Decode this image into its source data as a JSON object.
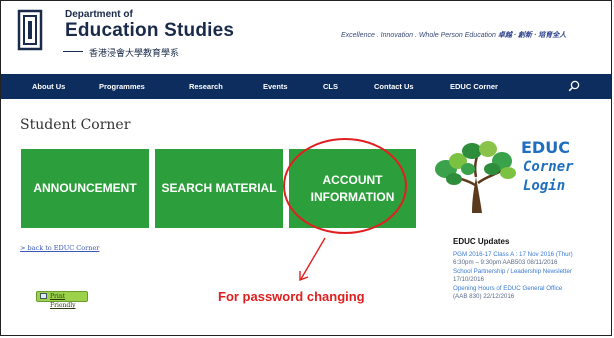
{
  "header": {
    "dept_line1": "Department of",
    "dept_line2": "Education Studies",
    "dept_line3": "香港浸會大學教育學系",
    "tagline": "Excellence . Innovation . Whole Person Education",
    "tagline_zh": "卓越 · 創新 · 培育全人"
  },
  "nav": {
    "items": [
      "About Us",
      "Programmes",
      "Research",
      "Events",
      "CLS",
      "Contact Us",
      "EDUC Corner"
    ],
    "search_icon": "search-icon",
    "background": "#0d2d5e"
  },
  "main": {
    "title": "Student Corner",
    "tiles": [
      "ANNOUNCEMENT",
      "SEARCH MATERIAL",
      "ACCOUNT\nINFORMATION"
    ],
    "tile_color": "#2d9e3c",
    "back_link": "> back to EDUC Corner",
    "print_button": "Print Friendly",
    "annotation": "For password changing",
    "annotation_color": "#e01f1f"
  },
  "sidebar": {
    "logo_word1": "EDUC",
    "logo_word2": "Corner",
    "logo_word3": "Login",
    "updates_title": "EDUC Updates",
    "updates": [
      {
        "text": "PGM 2016-17 Class A : 17 Nov 2016 (Thur)",
        "type": "link"
      },
      {
        "text": "6:30pm – 9:30pm AAB503 08/11/2016",
        "type": "date"
      },
      {
        "text": "School Partnership / Leadership Newsletter",
        "type": "link"
      },
      {
        "text": "17/10/2016",
        "type": "date"
      },
      {
        "text": "Opening Hours of EDUC General Office",
        "type": "link"
      },
      {
        "text": "(AAB 830) 22/12/2016",
        "type": "date"
      }
    ]
  }
}
